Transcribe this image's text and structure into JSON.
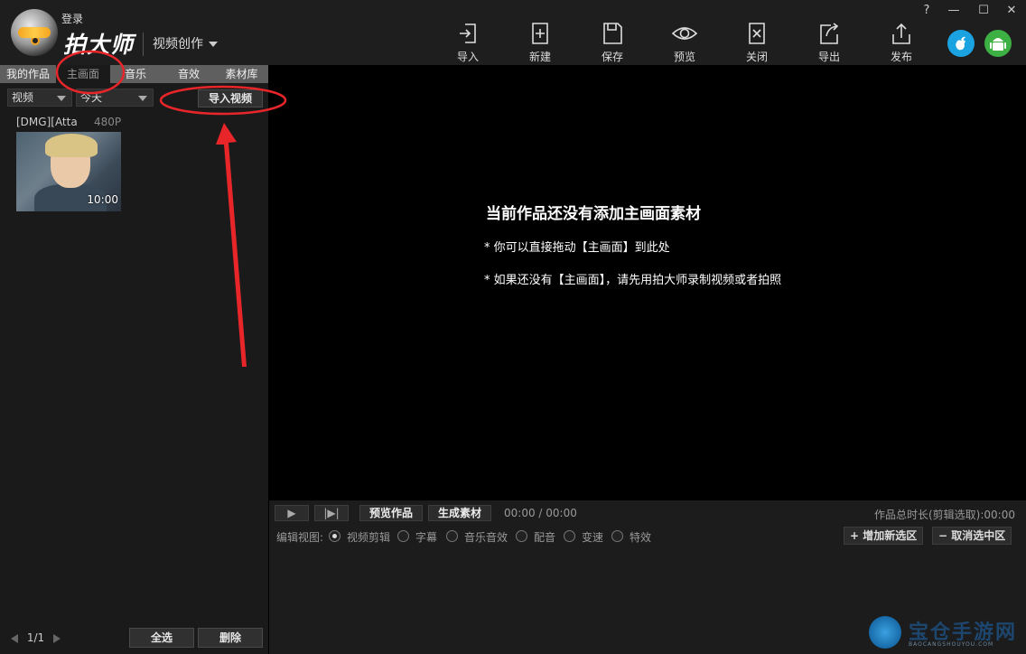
{
  "header": {
    "login_label": "登录",
    "app_name": "拍大师",
    "mode_label": "视频创作"
  },
  "toolbar": [
    {
      "label": "导入",
      "icon": "import-icon"
    },
    {
      "label": "新建",
      "icon": "new-file-icon"
    },
    {
      "label": "保存",
      "icon": "save-icon"
    },
    {
      "label": "预览",
      "icon": "eye-icon"
    },
    {
      "label": "关闭",
      "icon": "close-file-icon"
    },
    {
      "label": "导出",
      "icon": "export-icon"
    },
    {
      "label": "发布",
      "icon": "upload-icon"
    }
  ],
  "window": {
    "help": "?",
    "minimize": "—",
    "maximize": "☐",
    "close": "✕"
  },
  "platform_icons": [
    "apple-icon",
    "android-icon"
  ],
  "left_panel": {
    "tabs": [
      {
        "label": "我的作品",
        "active": false
      },
      {
        "label": "主画面",
        "active": true
      },
      {
        "label": "音乐",
        "active": false
      },
      {
        "label": "音效",
        "active": false
      },
      {
        "label": "素材库",
        "active": false
      }
    ],
    "type_filter": "视频",
    "date_filter": "今天",
    "import_button": "导入视频",
    "items": [
      {
        "name": "[DMG][Atta",
        "resolution": "480P",
        "duration": "10:00"
      }
    ],
    "page": "1/1",
    "select_all": "全选",
    "delete": "删除"
  },
  "canvas": {
    "title": "当前作品还没有添加主画面素材",
    "line1": "* 你可以直接拖动【主画面】到此处",
    "line2": "* 如果还没有【主画面】，请先用拍大师录制视频或者拍照"
  },
  "editor": {
    "play": "▶",
    "step": "|▶|",
    "preview_work": "预览作品",
    "generate": "生成素材",
    "time": "00:00 / 00:00",
    "total_label": "作品总时长(剪辑选取):00:00",
    "view_label": "编辑视图:",
    "views": [
      {
        "label": "视频剪辑",
        "selected": true
      },
      {
        "label": "字幕",
        "selected": false
      },
      {
        "label": "音乐音效",
        "selected": false
      },
      {
        "label": "配音",
        "selected": false
      },
      {
        "label": "变速",
        "selected": false
      },
      {
        "label": "特效",
        "selected": false
      }
    ],
    "add_region": "增加新选区",
    "cancel_region": "取消选中区"
  },
  "watermark": {
    "text": "宝仓手游网",
    "sub": "BAOCANGSHOUYOU.COM"
  },
  "colors": {
    "accent_red": "#e8262a",
    "apple_blue": "#1aa3e0",
    "android_green": "#3cb043"
  }
}
